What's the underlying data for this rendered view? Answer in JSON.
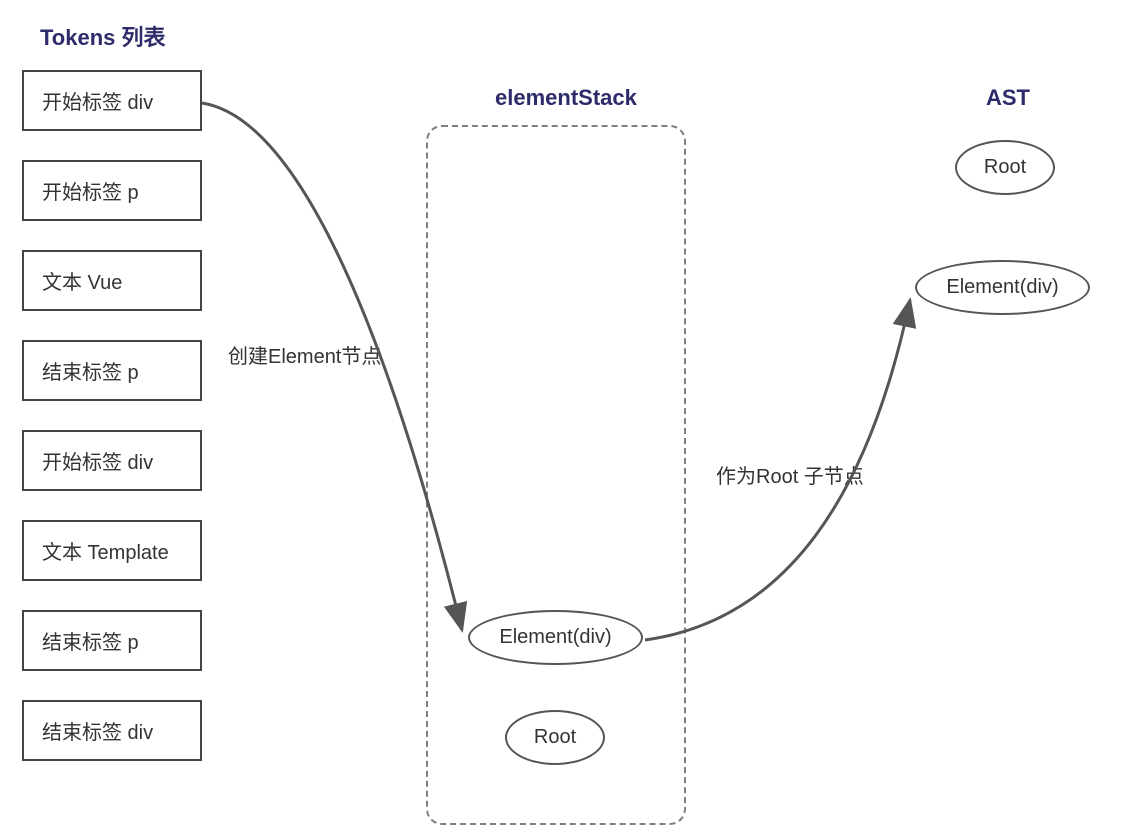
{
  "headings": {
    "tokens": "Tokens 列表",
    "stack": "elementStack",
    "ast": "AST"
  },
  "tokens": [
    "开始标签 div",
    "开始标签 p",
    "文本 Vue",
    "结束标签 p",
    "开始标签 div",
    "文本 Template",
    "结束标签 p",
    "结束标签 div"
  ],
  "stack": {
    "elementDiv": "Element(div)",
    "root": "Root"
  },
  "ast": {
    "root": "Root",
    "elementDiv": "Element(div)"
  },
  "labels": {
    "createElement": "创建Element节点",
    "asRootChild": "作为Root 子节点"
  }
}
